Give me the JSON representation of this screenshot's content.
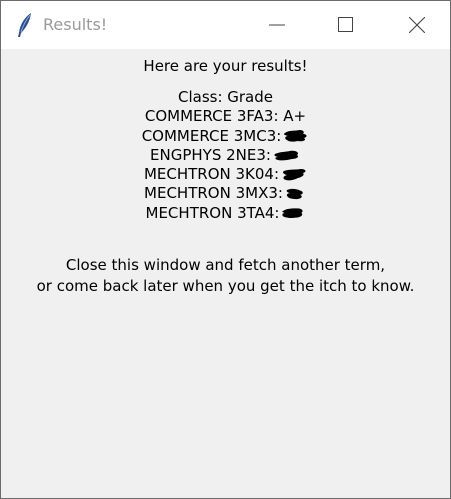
{
  "window": {
    "title": "Results!",
    "icon": "feather-icon"
  },
  "controls": {
    "minimize_icon": "minimize-icon",
    "maximize_icon": "maximize-icon",
    "close_icon": "close-icon"
  },
  "content": {
    "header": "Here are your results!",
    "column_header": "Class: Grade",
    "results": [
      {
        "label": "COMMERCE 3FA3: A+",
        "redacted": false
      },
      {
        "label": "COMMERCE 3MC3:",
        "redacted": true
      },
      {
        "label": "ENGPHYS 2NE3:",
        "redacted": true
      },
      {
        "label": "MECHTRON 3K04:",
        "redacted": true
      },
      {
        "label": "MECHTRON 3MX3:",
        "redacted": true
      },
      {
        "label": "MECHTRON 3TA4:",
        "redacted": true
      }
    ],
    "footer_line1": "Close this window and fetch another term,",
    "footer_line2": "or come back later when you get the itch to know."
  },
  "colors": {
    "window_bg": "#f0f0f0",
    "titlebar_bg": "#ffffff",
    "title_text": "#9a9a9a",
    "redaction": "#000000"
  }
}
